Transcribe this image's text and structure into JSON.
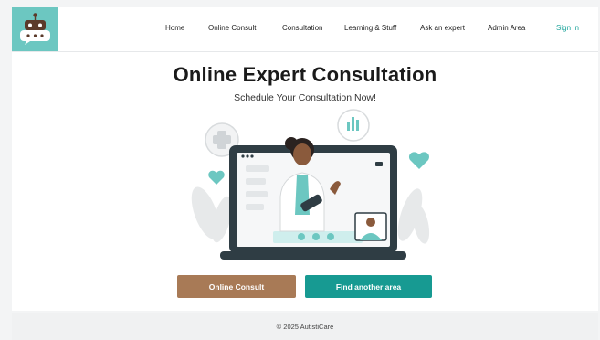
{
  "brand": {
    "logo_icon": "robot-chat-icon",
    "accent_color": "#6cc7c1"
  },
  "nav": {
    "items": [
      {
        "label": "Home"
      },
      {
        "label": "Online Consult"
      },
      {
        "label": "Consultation"
      },
      {
        "label": "Learning & Stuff"
      },
      {
        "label": "Ask an expert"
      },
      {
        "label": "Admin Area"
      }
    ],
    "sign_in": "Sign In"
  },
  "hero": {
    "title": "Online Expert Consultation",
    "subtitle": "Schedule Your Consultation Now!",
    "illustration": "doctor-video-call-illustration"
  },
  "actions": {
    "online_consult": "Online Consult",
    "find_area": "Find another area",
    "online_consult_color": "#a87a56",
    "find_area_color": "#179a92"
  },
  "footer": {
    "copyright": "© 2025 AutistiCare"
  }
}
